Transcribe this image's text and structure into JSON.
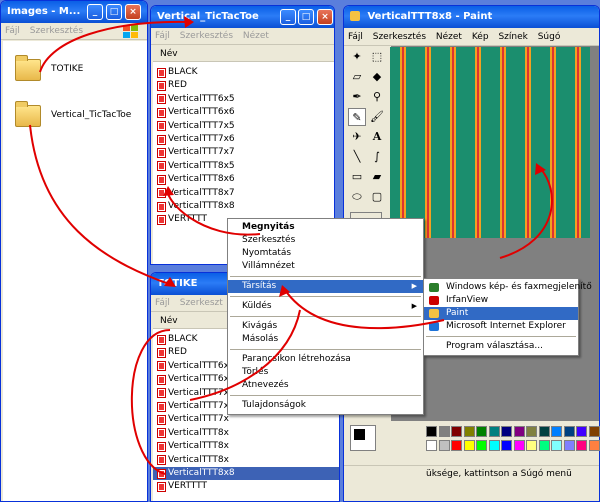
{
  "win_images": {
    "title": "Images - M...",
    "menu": [
      "Fájl",
      "Szerkesztés"
    ],
    "folders": [
      "TOTIKE",
      "Vertical_TicTacToe"
    ]
  },
  "win_vttt": {
    "title": "Vertical_TicTacToe",
    "menu": [
      "Fájl",
      "Szerkesztés",
      "Nézet"
    ],
    "col_name": "Név",
    "files": [
      "BLACK",
      "RED",
      "VerticalTTT6x5",
      "VerticalTTT6x6",
      "VerticalTTT7x5",
      "VerticalTTT7x6",
      "VerticalTTT7x7",
      "VerticalTTT8x5",
      "VerticalTTT8x6",
      "VerticalTTT8x7",
      "VerticalTTT8x8",
      "VERTTTT"
    ]
  },
  "win_totike": {
    "title": "TOTIKE",
    "menu": [
      "Fájl",
      "Szerkeszt"
    ],
    "col_name": "Név",
    "files": [
      "BLACK",
      "RED",
      "VerticalTTT6x",
      "VerticalTTT6x",
      "VerticalTTT7x",
      "VerticalTTT7x",
      "VerticalTTT7x",
      "VerticalTTT8x",
      "VerticalTTT8x",
      "VerticalTTT8x",
      "VerticalTTT8x8",
      "VERTTTT"
    ],
    "selected_index": 10
  },
  "win_paint": {
    "title": "VerticalTTT8x8 - Paint",
    "menu": [
      "Fájl",
      "Szerkesztés",
      "Nézet",
      "Kép",
      "Színek",
      "Súgó"
    ],
    "status": "üksége, kattintson a Súgó menü"
  },
  "context_menu": {
    "items": [
      {
        "label": "Megnyitás",
        "bold": true
      },
      {
        "label": "Szerkesztés"
      },
      {
        "label": "Nyomtatás"
      },
      {
        "label": "Villámnézet"
      },
      {
        "sep": true
      },
      {
        "label": "Társítás",
        "sub": true,
        "hl": true
      },
      {
        "sep": true
      },
      {
        "label": "Küldés",
        "sub": true
      },
      {
        "sep": true
      },
      {
        "label": "Kivágás"
      },
      {
        "label": "Másolás"
      },
      {
        "sep": true
      },
      {
        "label": "Parancsikon létrehozása"
      },
      {
        "label": "Törlés"
      },
      {
        "label": "Átnevezés"
      },
      {
        "sep": true
      },
      {
        "label": "Tulajdonságok"
      }
    ]
  },
  "submenu": {
    "items": [
      "Windows kép- és faxmegjelenítő",
      "IrfanView",
      "Paint",
      "Microsoft Internet Explorer",
      "Program választása..."
    ],
    "highlighted_index": 2
  },
  "palette": [
    "#000000",
    "#808080",
    "#800000",
    "#808000",
    "#008000",
    "#008080",
    "#000080",
    "#800080",
    "#808040",
    "#004040",
    "#0080ff",
    "#004080",
    "#4000ff",
    "#804000"
  ],
  "colors": {
    "accent_arrow": "#e00000",
    "titlebar": "#0a5fe6",
    "selection": "#316ac5"
  }
}
